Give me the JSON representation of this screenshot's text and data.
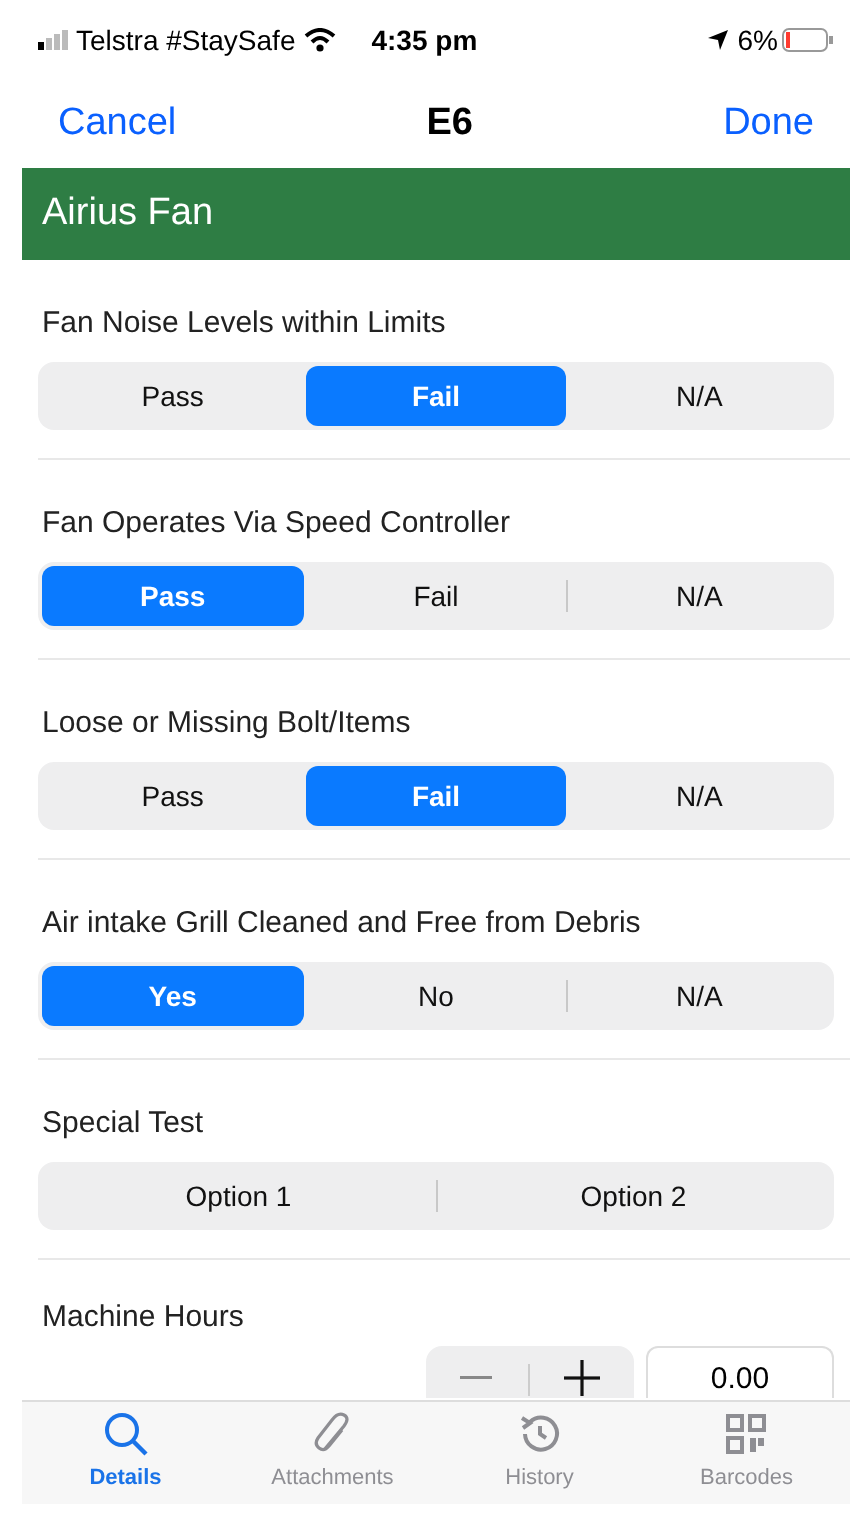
{
  "status_bar": {
    "carrier": "Telstra #StaySafe",
    "time": "4:35 pm",
    "battery": "6%"
  },
  "nav": {
    "cancel": "Cancel",
    "title": "E6",
    "done": "Done"
  },
  "section_title": "Airius Fan",
  "questions": [
    {
      "label": "Fan Noise Levels within Limits",
      "options": [
        {
          "label": "Pass",
          "selected": false
        },
        {
          "label": "Fail",
          "selected": true
        },
        {
          "label": "N/A",
          "selected": false
        }
      ]
    },
    {
      "label": "Fan Operates Via Speed Controller",
      "options": [
        {
          "label": "Pass",
          "selected": true
        },
        {
          "label": "Fail",
          "selected": false
        },
        {
          "label": "N/A",
          "selected": false
        }
      ]
    },
    {
      "label": "Loose or Missing Bolt/Items",
      "options": [
        {
          "label": "Pass",
          "selected": false
        },
        {
          "label": "Fail",
          "selected": true
        },
        {
          "label": "N/A",
          "selected": false
        }
      ]
    },
    {
      "label": "Air intake Grill Cleaned and Free from Debris",
      "options": [
        {
          "label": "Yes",
          "selected": true
        },
        {
          "label": "No",
          "selected": false
        },
        {
          "label": "N/A",
          "selected": false
        }
      ]
    },
    {
      "label": "Special Test",
      "options": [
        {
          "label": "Option 1",
          "selected": false
        },
        {
          "label": "Option 2",
          "selected": false
        }
      ]
    }
  ],
  "machine_hours": {
    "label": "Machine Hours",
    "value": "0.00"
  },
  "tabs": [
    {
      "kind": "search",
      "label": "Details",
      "selected": true
    },
    {
      "kind": "clip",
      "label": "Attachments",
      "selected": false
    },
    {
      "kind": "history",
      "label": "History",
      "selected": false
    },
    {
      "kind": "qr",
      "label": "Barcodes",
      "selected": false
    }
  ]
}
